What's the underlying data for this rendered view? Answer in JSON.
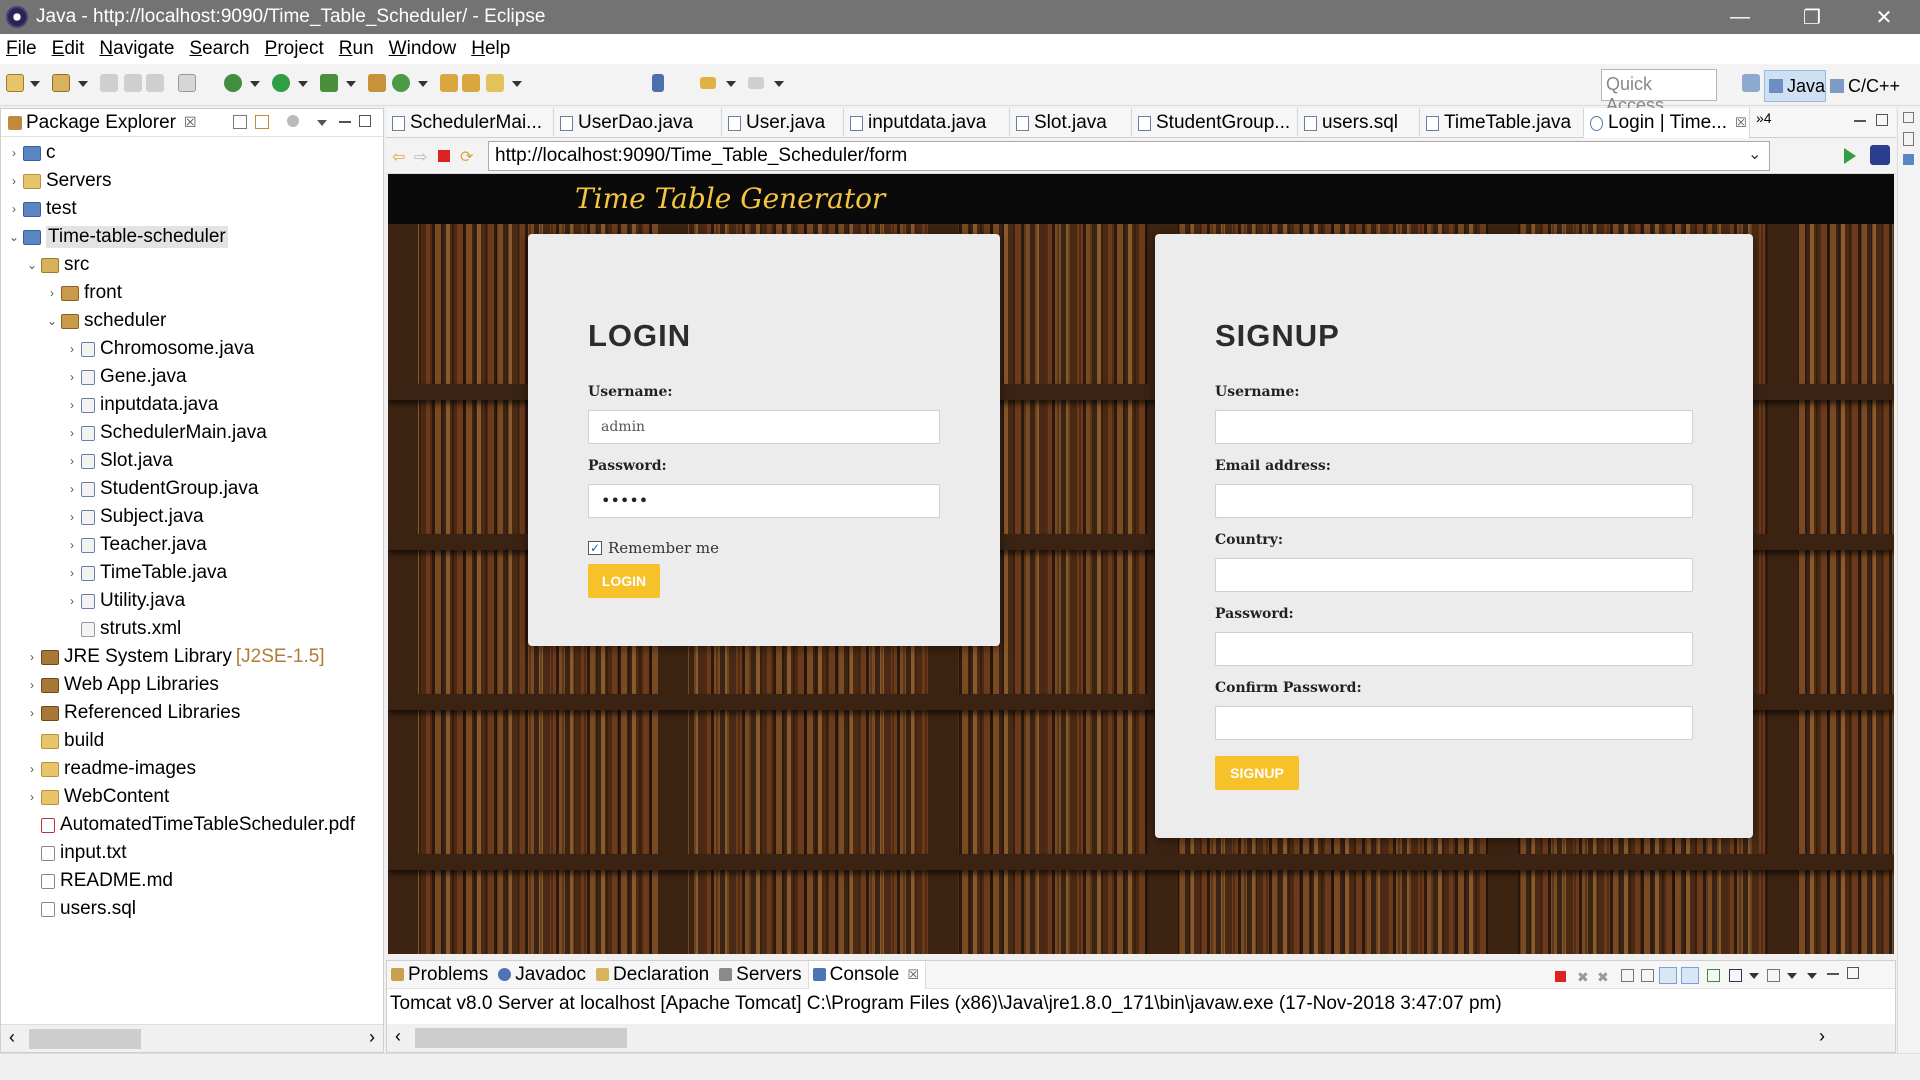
{
  "window": {
    "title": "Java - http://localhost:9090/Time_Table_Scheduler/ - Eclipse",
    "minimize": "—",
    "restore": "❐",
    "close": "✕"
  },
  "menu": [
    "File",
    "Edit",
    "Navigate",
    "Search",
    "Project",
    "Run",
    "Window",
    "Help"
  ],
  "toolbar": {
    "quick_access_placeholder": "Quick Access",
    "perspective_java": "Java",
    "perspective_cpp": "C/C++"
  },
  "package_explorer": {
    "tab_label": "Package Explorer",
    "tab_close": "☒",
    "items": [
      {
        "label": "c",
        "deco": ""
      },
      {
        "label": "Servers",
        "deco": ""
      },
      {
        "label": "test",
        "deco": ""
      },
      {
        "label": "Time-table-scheduler",
        "deco": ""
      },
      {
        "label": "src",
        "deco": ""
      },
      {
        "label": "front",
        "deco": ""
      },
      {
        "label": "scheduler",
        "deco": ""
      },
      {
        "label": "Chromosome.java",
        "deco": ""
      },
      {
        "label": "Gene.java",
        "deco": ""
      },
      {
        "label": "inputdata.java",
        "deco": ""
      },
      {
        "label": "SchedulerMain.java",
        "deco": ""
      },
      {
        "label": "Slot.java",
        "deco": ""
      },
      {
        "label": "StudentGroup.java",
        "deco": ""
      },
      {
        "label": "Subject.java",
        "deco": ""
      },
      {
        "label": "Teacher.java",
        "deco": ""
      },
      {
        "label": "TimeTable.java",
        "deco": ""
      },
      {
        "label": "Utility.java",
        "deco": ""
      },
      {
        "label": "struts.xml",
        "deco": ""
      },
      {
        "label": "JRE System Library",
        "deco": "[J2SE-1.5]"
      },
      {
        "label": "Web App Libraries",
        "deco": ""
      },
      {
        "label": "Referenced Libraries",
        "deco": ""
      },
      {
        "label": "build",
        "deco": ""
      },
      {
        "label": "readme-images",
        "deco": ""
      },
      {
        "label": "WebContent",
        "deco": ""
      },
      {
        "label": "AutomatedTimeTableScheduler.pdf",
        "deco": ""
      },
      {
        "label": "input.txt",
        "deco": ""
      },
      {
        "label": "README.md",
        "deco": ""
      },
      {
        "label": "users.sql",
        "deco": ""
      }
    ]
  },
  "editor_tabs": [
    "SchedulerMai...",
    "UserDao.java",
    "User.java",
    "inputdata.java",
    "Slot.java",
    "StudentGroup...",
    "users.sql",
    "TimeTable.java",
    "Login | Time...",
    "»4"
  ],
  "browser": {
    "url": "http://localhost:9090/Time_Table_Scheduler/form"
  },
  "webpage": {
    "site_title": "Time Table Generator",
    "login": {
      "heading": "LOGIN",
      "username_label": "Username:",
      "username_value": "admin",
      "password_label": "Password:",
      "password_value": "•••••",
      "remember_label": "Remember me",
      "remember_checked": "✓",
      "button": "LOGIN"
    },
    "signup": {
      "heading": "SIGNUP",
      "username_label": "Username:",
      "email_label": "Email address:",
      "country_label": "Country:",
      "password_label": "Password:",
      "confirm_label": "Confirm Password:",
      "button": "SIGNUP"
    }
  },
  "console": {
    "tabs": [
      "Problems",
      "Javadoc",
      "Declaration",
      "Servers",
      "Console"
    ],
    "active_tab_close": "☒",
    "text": "Tomcat v8.0 Server at localhost [Apache Tomcat] C:\\Program Files (x86)\\Java\\jre1.8.0_171\\bin\\javaw.exe (17-Nov-2018 3:47:07 pm)"
  }
}
